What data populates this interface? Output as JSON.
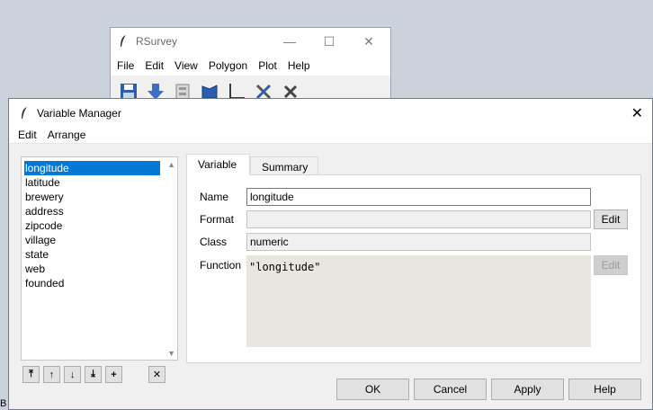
{
  "background_window": {
    "title": "RSurvey",
    "menu": [
      "File",
      "Edit",
      "View",
      "Polygon",
      "Plot",
      "Help"
    ],
    "controls": {
      "minimize": "—",
      "maximize": "☐",
      "close": "✕"
    }
  },
  "dialog": {
    "title": "Variable Manager",
    "close": "✕",
    "menu": [
      "Edit",
      "Arrange"
    ],
    "variables": [
      "longitude",
      "latitude",
      "brewery",
      "address",
      "zipcode",
      "village",
      "state",
      "web",
      "founded"
    ],
    "selected_index": 0,
    "tabs": [
      "Variable",
      "Summary"
    ],
    "active_tab": "Variable",
    "fields": {
      "name_label": "Name",
      "name_value": "longitude",
      "format_label": "Format",
      "format_value": "",
      "class_label": "Class",
      "class_value": "numeric",
      "function_label": "Function",
      "function_value": "\"longitude\""
    },
    "format_edit_label": "Edit",
    "function_edit_label": "Edit",
    "buttons": {
      "ok": "OK",
      "cancel": "Cancel",
      "apply": "Apply",
      "help": "Help"
    },
    "scroll": {
      "up": "▲",
      "down": "▼"
    },
    "list_buttons": {
      "top": "⤒",
      "up": "↑",
      "down": "↓",
      "bottom": "⤓",
      "add": "+",
      "delete": "✕"
    }
  },
  "edge_char": "B"
}
